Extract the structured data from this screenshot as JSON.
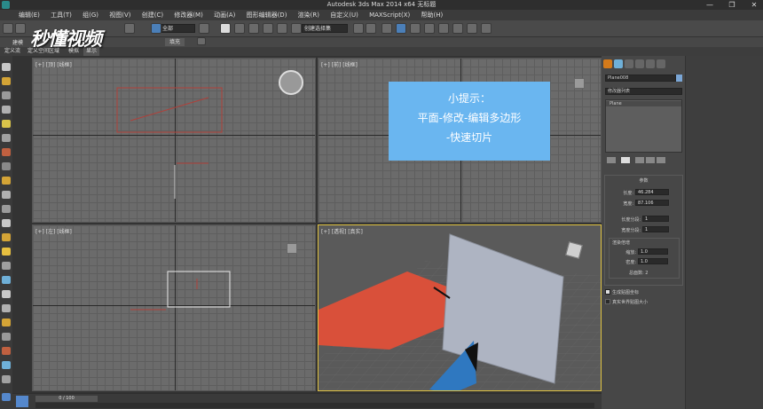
{
  "window": {
    "title": "Autodesk 3ds Max  2014 x64     无标题",
    "minimize": "—",
    "maximize": "❐",
    "close": "✕"
  },
  "menubar": {
    "items": [
      "编辑(E)",
      "工具(T)",
      "组(G)",
      "视图(V)",
      "创建(C)",
      "修改器(M)",
      "动画(A)",
      "图形编辑器(D)",
      "渲染(R)",
      "自定义(U)",
      "MAXScript(X)",
      "帮助(H)"
    ]
  },
  "toolbar": {
    "selection_filter": "全部",
    "named_selection": "创建选择集"
  },
  "ribbon": {
    "modeling_label": "建模",
    "fill_label": "填充"
  },
  "subtabs": [
    "定义流",
    "定义空间区域",
    "模拟",
    "显示"
  ],
  "viewports": {
    "top_label": "[+] [顶] [线框]",
    "front_label": "[+] [前] [线框]",
    "left_label": "[+] [左] [线框]",
    "persp_label": "[+] [透视] [真实]"
  },
  "tip": {
    "line1": "小提示：",
    "line2": "平面-修改-编辑多边形",
    "line3": "-快速切片"
  },
  "command_panel": {
    "object_name": "Plane008",
    "modifier_list": "修改器列表",
    "stack_item": "Plane",
    "params_title": "参数",
    "length_label": "长度:",
    "length_value": "46.284",
    "width_label": "宽度:",
    "width_value": "87.106",
    "length_segs_label": "长度分段:",
    "length_segs_value": "1",
    "width_segs_label": "宽度分段:",
    "width_segs_value": "1",
    "render_mult_title": "渲染倍增",
    "scale_label": "缩放:",
    "scale_value": "1.0",
    "density_label": "密度:",
    "density_value": "1.0",
    "total_faces": "总面数: 2",
    "gen_map_coords": "生成贴图坐标",
    "real_world_map": "真实世界贴图大小"
  },
  "status": {
    "time_slider": "0 / 100"
  },
  "watermark": "秒懂视频",
  "colors": {
    "tip_bg": "#6ab6f0",
    "persp_border": "#e0c341",
    "plane_red": "#d9503a",
    "plane_blue": "#2f78c0",
    "toolbar_blue": "#4b7fb8"
  }
}
